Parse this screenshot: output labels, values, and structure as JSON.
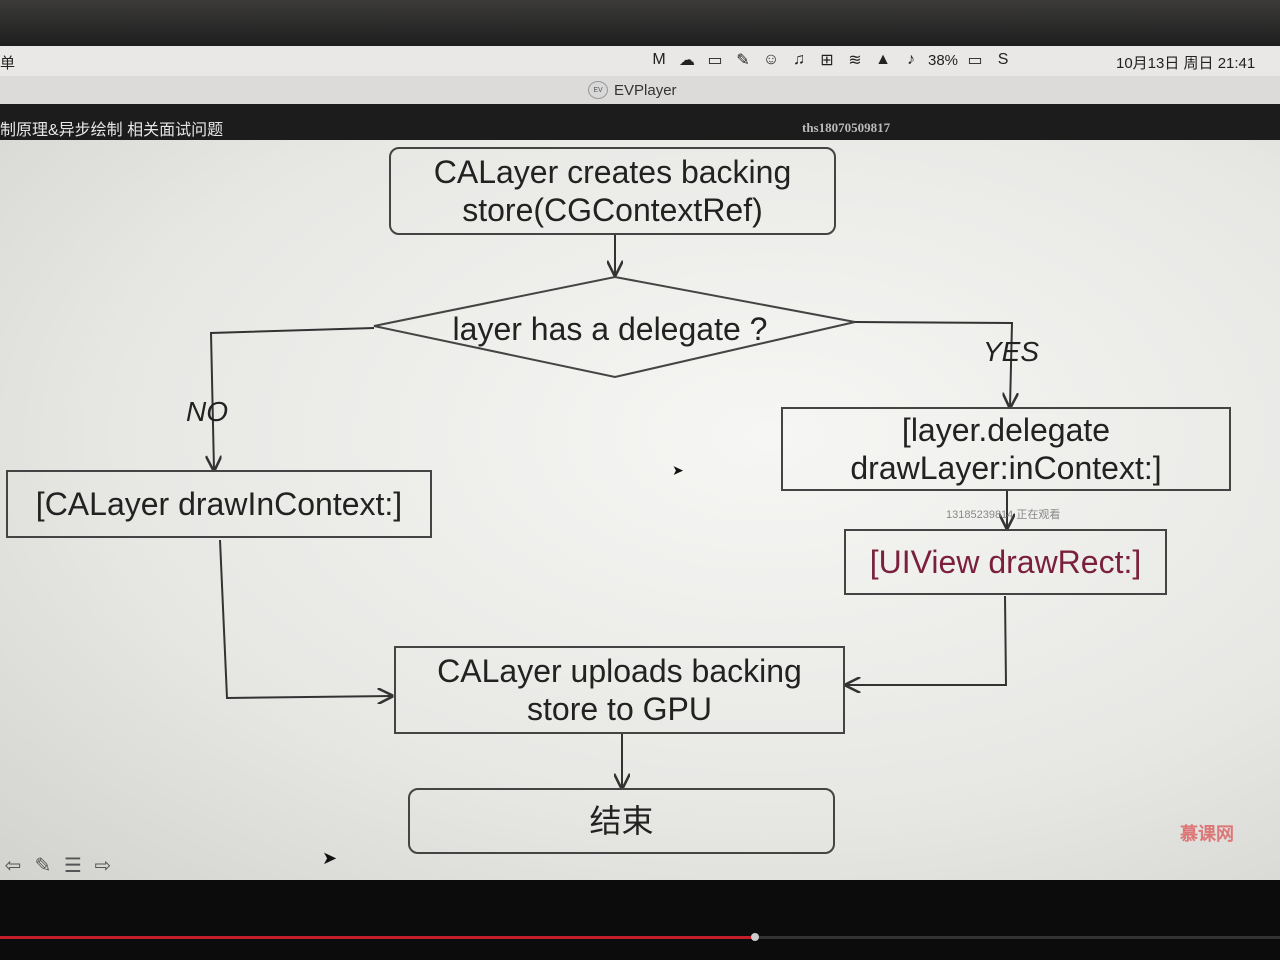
{
  "menubar": {
    "app_menu": "单",
    "icons": [
      "gmail-icon",
      "cloud-icon",
      "screen-icon",
      "evernote-icon",
      "face-icon",
      "mic-icon",
      "input-method-icon",
      "wifi-icon",
      "airplay-icon",
      "volume-icon",
      "battery-icon",
      "sogou-icon"
    ],
    "battery": "38%",
    "datetime": "10月13日 周日 21:41"
  },
  "window": {
    "title": "EVPlayer",
    "app_icon_text": "EV"
  },
  "slide_header": {
    "topic": "制原理&异步绘制 相关面试问题",
    "watermark": "ths18070509817"
  },
  "flowchart": {
    "start": "CALayer creates backing store(CGContextRef)",
    "decision": "layer has a delegate ?",
    "no_label": "NO",
    "yes_label": "YES",
    "no_box": "[CALayer drawInContext:]",
    "yes_box": "[layer.delegate drawLayer:inContext:]",
    "drawrect_box": "[UIView drawRect:]",
    "upload_box": "CALayer uploads backing store to GPU",
    "end_box": "结束"
  },
  "viewer_note": "13185239814 正在观看",
  "brand_logo": "慕课网",
  "playback": {
    "progress": 0.59
  },
  "colors": {
    "accent": "#c21f2a",
    "drawrect_text": "#7a1f3d"
  }
}
